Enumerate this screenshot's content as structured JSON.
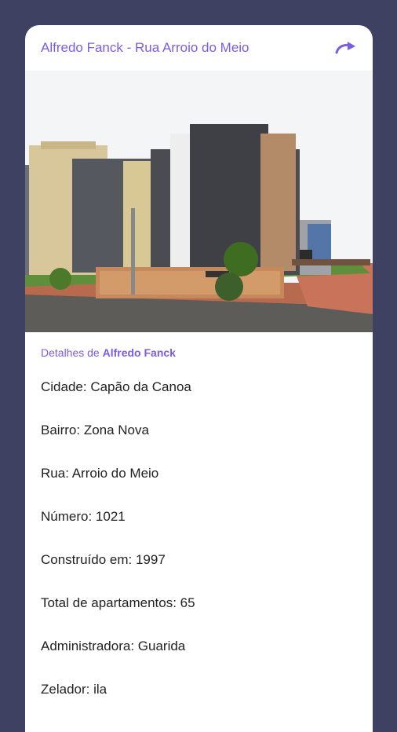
{
  "header": {
    "title": "Alfredo Fanck - Rua Arroio do Meio",
    "share_icon": "share-arrow-icon"
  },
  "details": {
    "prefix": "Detalhes de",
    "name": "Alfredo Fanck"
  },
  "info": [
    {
      "label": "Cidade",
      "value": "Capão da Canoa"
    },
    {
      "label": "Bairro",
      "value": "Zona Nova"
    },
    {
      "label": "Rua",
      "value": "Arroio do Meio"
    },
    {
      "label": "Número",
      "value": "1021"
    },
    {
      "label": "Construído em",
      "value": "1997"
    },
    {
      "label": "Total de apartamentos",
      "value": "65"
    },
    {
      "label": "Administradora",
      "value": "Guarida"
    },
    {
      "label": "Zelador",
      "value": "ila"
    }
  ],
  "colors": {
    "background": "#3f4163",
    "accent": "#7b5ce6",
    "card": "#ffffff"
  }
}
